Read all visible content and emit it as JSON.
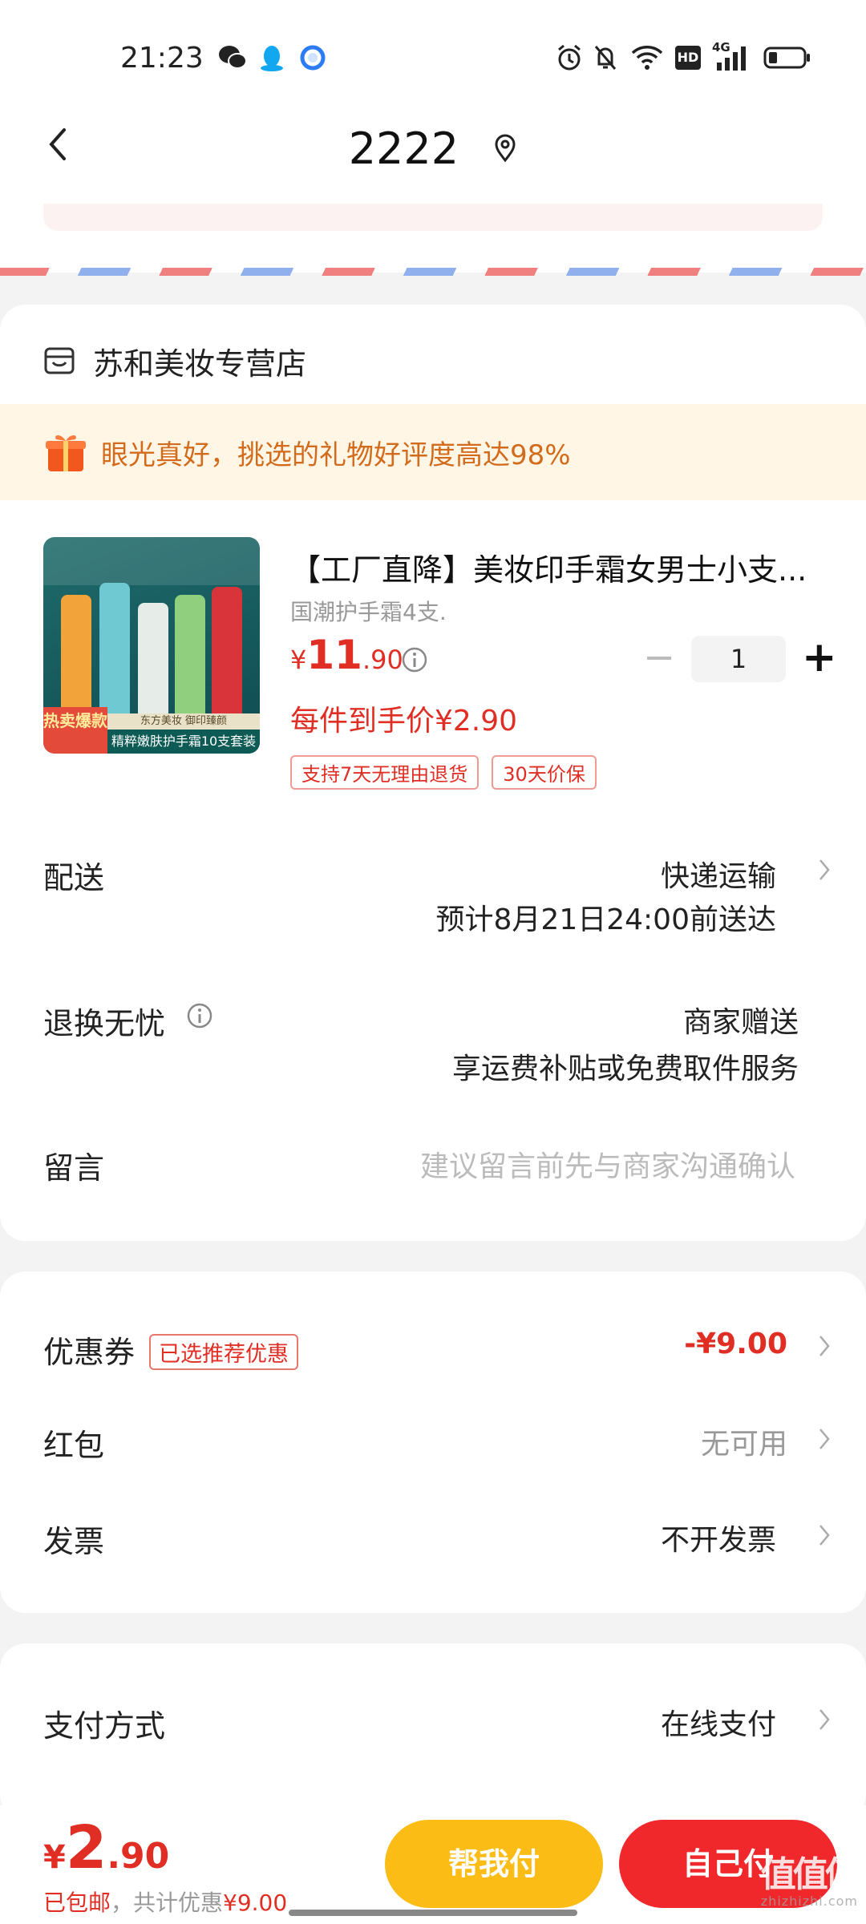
{
  "status_bar": {
    "time": "21:23",
    "network": "4G",
    "hd": "HD"
  },
  "header": {
    "title": "2222"
  },
  "store": {
    "name": "苏和美妆专营店",
    "promo_text": "眼光真好，挑选的礼物好评度高达98%"
  },
  "product": {
    "title": "【工厂直降】美妆印手霜女男士小支...",
    "spec": "国潮护手霜4支.",
    "price_yen": "¥",
    "price_int": "11",
    "price_dec": ".90",
    "quantity": "1",
    "unit_price": "每件到手价¥2.90",
    "tags": [
      "支持7天无理由退货",
      "30天价保"
    ],
    "image_text": {
      "hot": "热卖爆款",
      "top": "东方美妆 御印臻颜",
      "banner": "精粹嫩肤护手霜10支套装"
    }
  },
  "delivery": {
    "label": "配送",
    "method": "快递运输",
    "eta": "预计8月21日24:00前送达"
  },
  "returns": {
    "label": "退换无忧",
    "value": "商家赠送",
    "detail": "享运费补贴或免费取件服务"
  },
  "message": {
    "label": "留言",
    "placeholder": "建议留言前先与商家沟通确认"
  },
  "discounts": {
    "coupon_label": "优惠券",
    "coupon_badge": "已选推荐优惠",
    "coupon_value": "-¥9.00",
    "redpacket_label": "红包",
    "redpacket_value": "无可用",
    "invoice_label": "发票",
    "invoice_value": "不开发票"
  },
  "payment": {
    "label": "支付方式",
    "value": "在线支付"
  },
  "footer": {
    "total_yen": "¥",
    "total_int": "2",
    "total_dec": ".90",
    "note_shipping": "已包邮",
    "note_discount": "，共计优惠",
    "note_amount": "¥9.00",
    "btn_help": "帮我付",
    "btn_self": "自己付",
    "watermark": "值值值",
    "watermark_sub": "zhizhizhi.com"
  },
  "colors": {
    "accent_red": "#e02e24",
    "accent_yellow": "#fbbc15",
    "promo_orange": "#d36b1c"
  }
}
